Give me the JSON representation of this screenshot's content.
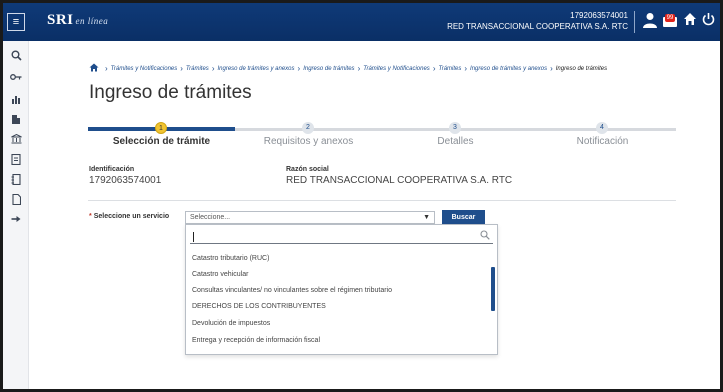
{
  "header": {
    "logo_text": "SRI",
    "logo_sub": "en línea",
    "user_id": "1792063574001",
    "user_name": "RED TRANSACCIONAL COOPERATIVA S.A. RTC",
    "mail_badge": "99",
    "icons": [
      "menu-icon",
      "user-icon",
      "mail-icon",
      "home-icon",
      "power-icon"
    ]
  },
  "sidebar": {
    "icons": [
      "search-icon",
      "key-icon",
      "chart-icon",
      "building-icon",
      "bank-icon",
      "document-icon",
      "notebook-icon",
      "file-icon",
      "arrow-right-icon"
    ]
  },
  "breadcrumb": {
    "items": [
      "Trámites y Notificaciones",
      "Trámites",
      "Ingreso de trámites y anexos",
      "Ingreso de trámites",
      "Trámites y Notificaciones",
      "Trámites",
      "Ingreso de trámites y anexos"
    ],
    "current": "Ingreso de trámites"
  },
  "page": {
    "title": "Ingreso de trámites"
  },
  "stepper": {
    "progress": 0.25,
    "steps": [
      {
        "number": "1",
        "label": "Selección de trámite",
        "active": true
      },
      {
        "number": "2",
        "label": "Requisitos y anexos",
        "active": false
      },
      {
        "number": "3",
        "label": "Detalles",
        "active": false
      },
      {
        "number": "4",
        "label": "Notificación",
        "active": false
      }
    ]
  },
  "taxpayer": {
    "id_label": "Identificación",
    "id_value": "1792063574001",
    "name_label": "Razón social",
    "name_value": "RED TRANSACCIONAL COOPERATIVA S.A. RTC"
  },
  "service": {
    "label": "Seleccione un servicio",
    "required_mark": "*",
    "select_value": "Seleccione...",
    "search_button": "Buscar",
    "options": [
      "Catastro tributario (RUC)",
      "Catastro vehicular",
      "Consultas vinculantes/ no vinculantes sobre el régimen tributario",
      "DERECHOS DE LOS CONTRIBUYENTES",
      "Devolución de impuestos",
      "Entrega y recepción de información fiscal"
    ]
  }
}
